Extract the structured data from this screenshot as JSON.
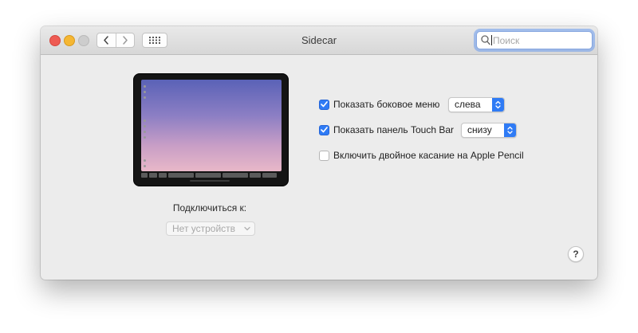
{
  "window": {
    "title": "Sidecar"
  },
  "toolbar": {
    "back_icon": "chevron-left-icon",
    "forward_icon": "chevron-right-icon",
    "grid_icon": "grid-icon"
  },
  "search": {
    "placeholder": "Поиск",
    "value": ""
  },
  "connect": {
    "label": "Подключиться к:",
    "selected": "Нет устройств"
  },
  "options": [
    {
      "label": "Показать боковое меню",
      "checked": true,
      "popup_value": "слева"
    },
    {
      "label": "Показать панель Touch Bar",
      "checked": true,
      "popup_value": "снизу"
    },
    {
      "label": "Включить двойное касание на Apple Pencil",
      "checked": false
    }
  ],
  "help": {
    "label": "?"
  },
  "colors": {
    "accent": "#2f7bf5",
    "close": "#ee5b53",
    "minimize": "#f5b733",
    "zoom_disabled": "#cdcdcd"
  }
}
